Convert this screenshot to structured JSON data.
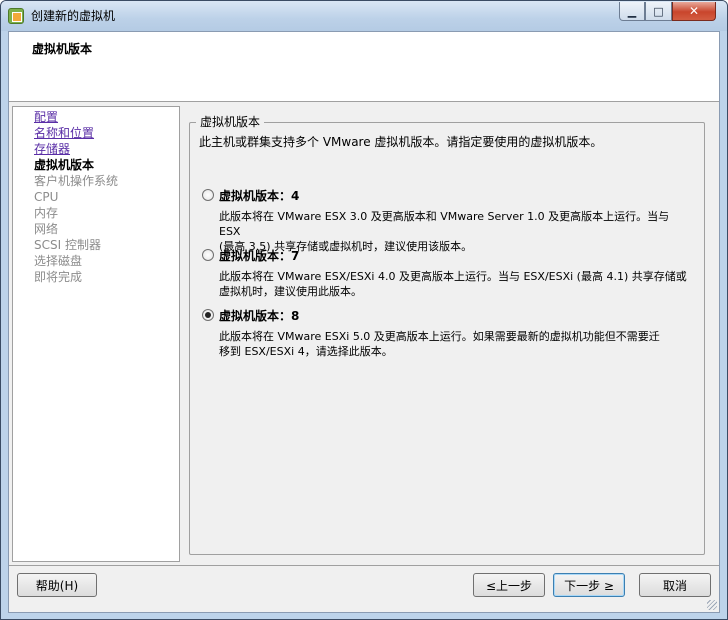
{
  "window": {
    "title": "创建新的虚拟机",
    "controls": {
      "minimize": "▁",
      "maximize": "□",
      "close": "✕"
    }
  },
  "header": {
    "title": "虚拟机版本"
  },
  "nav": {
    "items": [
      {
        "label": "配置",
        "state": "link"
      },
      {
        "label": "名称和位置",
        "state": "link"
      },
      {
        "label": "存储器",
        "state": "link"
      },
      {
        "label": "虚拟机版本",
        "state": "current"
      },
      {
        "label": "客户机操作系统",
        "state": "pending"
      },
      {
        "label": "CPU",
        "state": "pending"
      },
      {
        "label": "内存",
        "state": "pending"
      },
      {
        "label": "网络",
        "state": "pending"
      },
      {
        "label": "SCSI 控制器",
        "state": "pending"
      },
      {
        "label": "选择磁盘",
        "state": "pending"
      },
      {
        "label": "即将完成",
        "state": "pending"
      }
    ]
  },
  "content": {
    "group_label": "虚拟机版本",
    "intro": "此主机或群集支持多个 VMware 虚拟机版本。请指定要使用的虚拟机版本。",
    "options": [
      {
        "label": "虚拟机版本：4",
        "checked": false,
        "desc_line1": "此版本将在 VMware ESX 3.0 及更高版本和 VMware Server 1.0 及更高版本上运行。当与 ESX",
        "desc_line2": "(最高 3.5) 共享存储或虚拟机时，建议使用该版本。"
      },
      {
        "label": "虚拟机版本：7",
        "checked": false,
        "desc_line1": "此版本将在 VMware ESX/ESXi 4.0 及更高版本上运行。当与 ESX/ESXi (最高 4.1) 共享存储或",
        "desc_line2": "虚拟机时，建议使用此版本。"
      },
      {
        "label": "虚拟机版本：8",
        "checked": true,
        "desc_line1": "此版本将在 VMware ESXi 5.0 及更高版本上运行。如果需要最新的虚拟机功能但不需要迁",
        "desc_line2": "移到 ESX/ESXi 4，请选择此版本。"
      }
    ]
  },
  "buttons": {
    "help": "帮助(H)",
    "back": "≤上一步",
    "next": "下一步 ≥",
    "cancel": "取消"
  }
}
